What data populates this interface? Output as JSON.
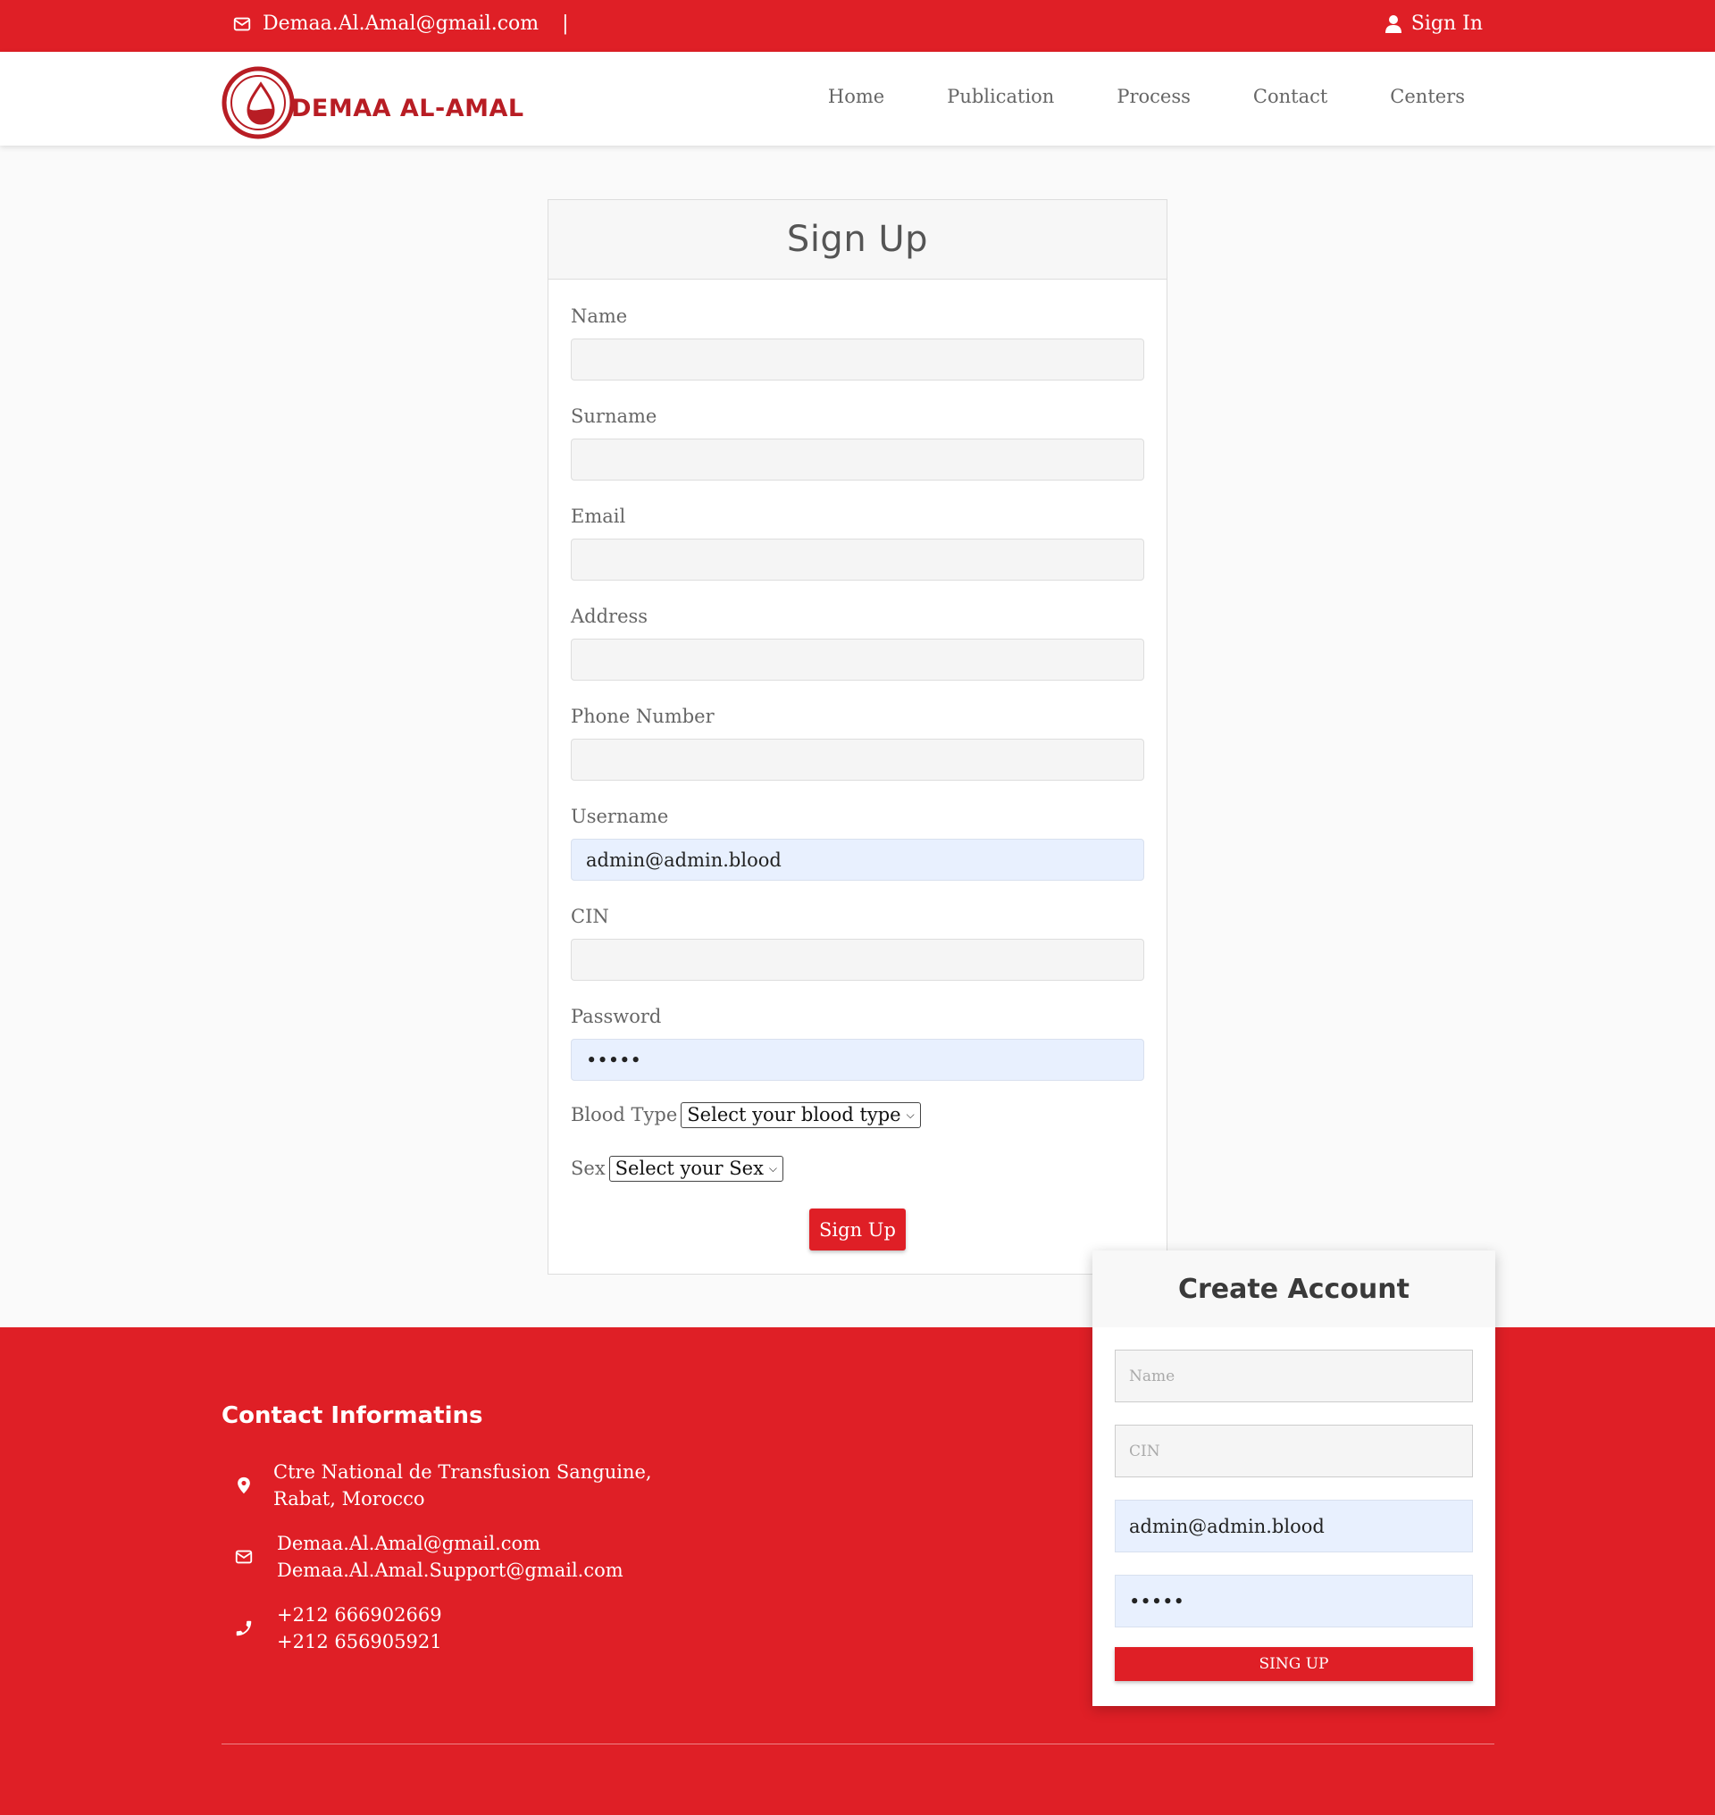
{
  "topbar": {
    "email": "Demaa.Al.Amal@gmail.com",
    "separator": "|",
    "signin_label": "Sign In"
  },
  "brand": {
    "name": "DEMAA AL-AMAL",
    "color": "#b81d24"
  },
  "nav": {
    "items": [
      {
        "label": "Home"
      },
      {
        "label": "Publication"
      },
      {
        "label": "Process"
      },
      {
        "label": "Contact"
      },
      {
        "label": "Centers"
      }
    ]
  },
  "signup": {
    "title": "Sign Up",
    "fields": {
      "name": {
        "label": "Name",
        "value": ""
      },
      "surname": {
        "label": "Surname",
        "value": ""
      },
      "email": {
        "label": "Email",
        "value": ""
      },
      "address": {
        "label": "Address",
        "value": ""
      },
      "phone": {
        "label": "Phone Number",
        "value": ""
      },
      "username": {
        "label": "Username",
        "value": "admin@admin.blood"
      },
      "cin": {
        "label": "CIN",
        "value": ""
      },
      "password": {
        "label": "Password",
        "value": "•••••"
      }
    },
    "blood_type": {
      "label": "Blood Type",
      "selected": "Select your blood type"
    },
    "sex": {
      "label": "Sex",
      "selected": "Select your Sex"
    },
    "submit_label": "Sign Up"
  },
  "footer": {
    "title": "Contact Informatins",
    "address": {
      "line1": "Ctre National de Transfusion Sanguine,",
      "line2": "Rabat, Morocco"
    },
    "emails": {
      "line1": "Demaa.Al.Amal@gmail.com",
      "line2": "Demaa.Al.Amal.Support@gmail.com"
    },
    "phones": {
      "line1": "+212 666902669",
      "line2": "+212 656905921"
    }
  },
  "create_account": {
    "title": "Create Account",
    "name_placeholder": "Name",
    "cin_placeholder": "CIN",
    "username_value": "admin@admin.blood",
    "password_value": "•••••",
    "submit_label": "SING UP"
  },
  "colors": {
    "accent": "#df1f26",
    "autofill": "#e8f0fe"
  }
}
